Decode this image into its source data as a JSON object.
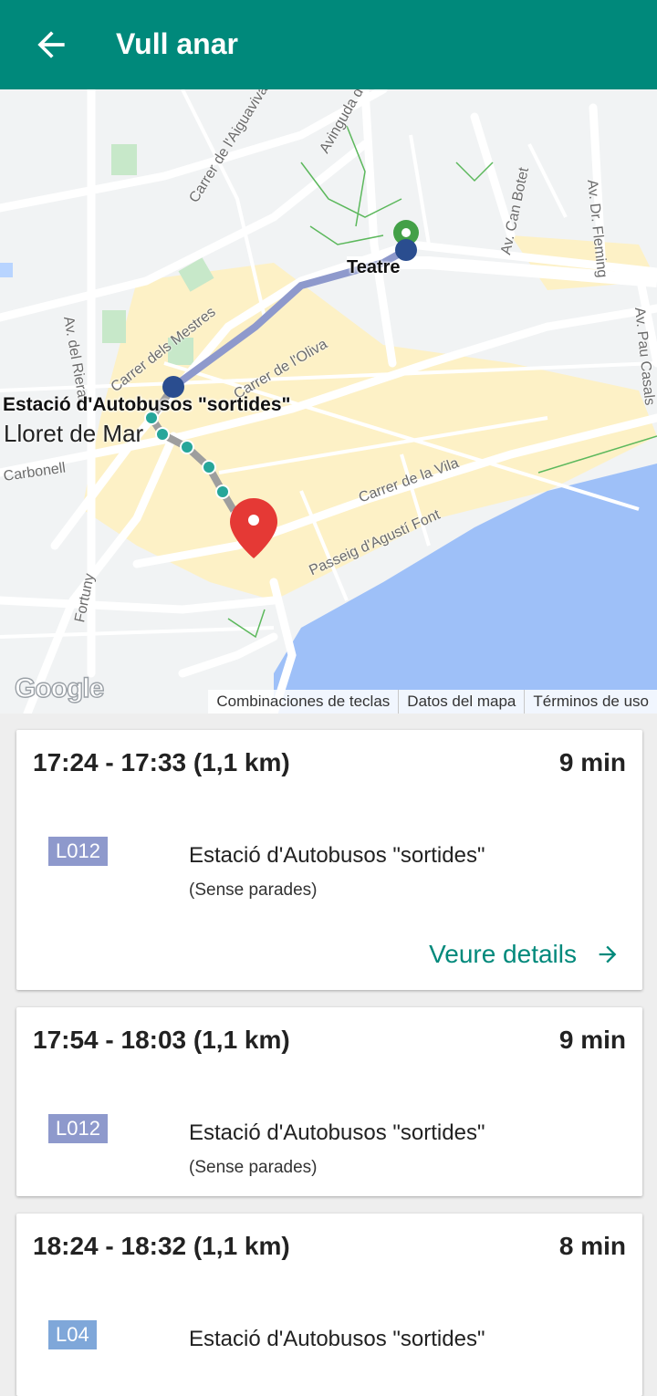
{
  "appbar": {
    "title": "Vull anar",
    "back_icon": "arrow-left-icon"
  },
  "map": {
    "origin_label": "Teatre",
    "destination_label": "Estació d'Autobusos \"sortides\"",
    "town_label": "Lloret de Mar",
    "streets": [
      "Carrer de l'Aiguaviva",
      "Avinguda de",
      "Av. Can Botet",
      "Av. Dr. Fleming",
      "Carrer dels Mestres",
      "Av. del Rieral",
      "Carrer de l'Oliva",
      "Av. Pau Casals",
      "Carrer de la Vila",
      "Passeig d'Agustí Font",
      "Carbonell",
      "Av. del Rieral",
      "Fortuny"
    ],
    "google": "Google",
    "attribution": [
      "Combinaciones de teclas",
      "Datos del mapa",
      "Términos de uso"
    ],
    "colors": {
      "route_bus": "#8e99cc",
      "route_walk": "#9e9e9e",
      "stop_dot": "#26a69a",
      "origin_pin": "#43a047",
      "bus_stop": "#2a4d8f",
      "destination_pin": "#e53935",
      "sea": "#9ec0f8",
      "land": "#f1f3f4",
      "urban": "#fdf1c6",
      "park": "#c7e8c9"
    }
  },
  "routes": [
    {
      "time": "17:24 - 17:33 (1,1 km)",
      "duration": "9 min",
      "line": "L012",
      "line_color": "#8e99cc",
      "stop": "Estació d'Autobusos \"sortides\"",
      "note": "(Sense parades)",
      "details_label": "Veure details"
    },
    {
      "time": "17:54 - 18:03 (1,1 km)",
      "duration": "9 min",
      "line": "L012",
      "line_color": "#8e99cc",
      "stop": "Estació d'Autobusos \"sortides\"",
      "note": "(Sense parades)"
    },
    {
      "time": "18:24 - 18:32 (1,1 km)",
      "duration": "8 min",
      "line": "L04",
      "line_color": "#7fa7d9",
      "stop": "Estació d'Autobusos \"sortides\"",
      "note": ""
    }
  ]
}
